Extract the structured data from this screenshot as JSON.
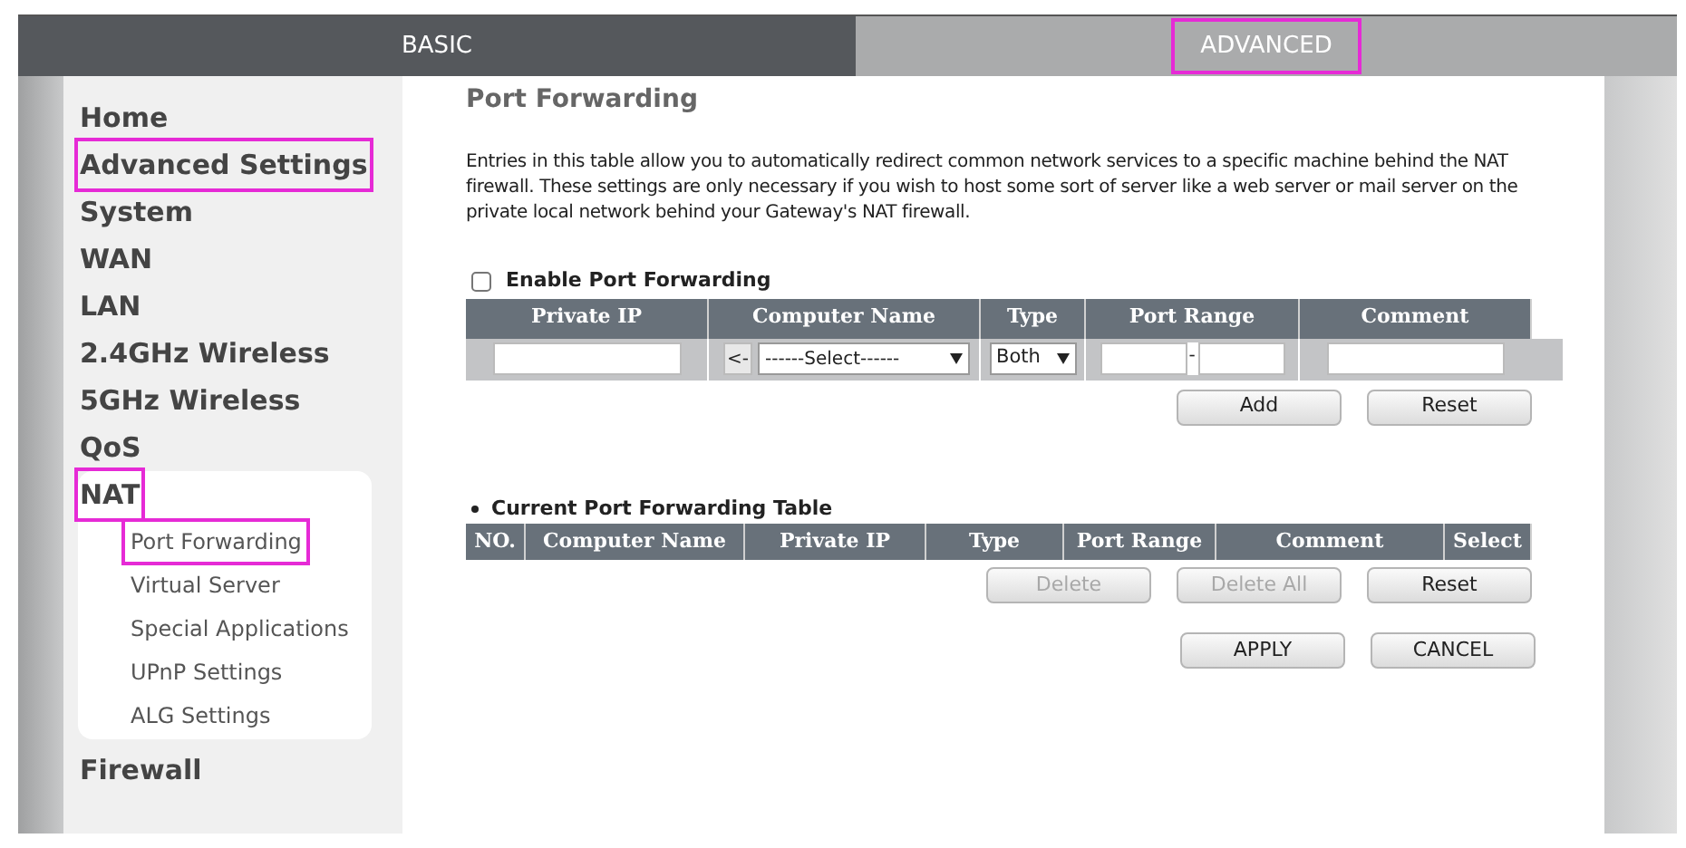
{
  "tabs": [
    {
      "label": "BASIC",
      "selected": true,
      "highlighted": false
    },
    {
      "label": "ADVANCED",
      "selected": false,
      "highlighted": true
    }
  ],
  "sidebar": {
    "items": [
      {
        "label": "Home",
        "highlighted": false
      },
      {
        "label": "Advanced Settings",
        "highlighted": true
      },
      {
        "label": "System",
        "highlighted": false
      },
      {
        "label": "WAN",
        "highlighted": false
      },
      {
        "label": "LAN",
        "highlighted": false
      },
      {
        "label": "2.4GHz Wireless",
        "highlighted": false
      },
      {
        "label": "5GHz Wireless",
        "highlighted": false
      },
      {
        "label": "QoS",
        "highlighted": false
      },
      {
        "label": "NAT",
        "highlighted": true,
        "children": [
          {
            "label": "Port Forwarding",
            "highlighted": true
          },
          {
            "label": "Virtual Server",
            "highlighted": false
          },
          {
            "label": "Special Applications",
            "highlighted": false
          },
          {
            "label": "UPnP Settings",
            "highlighted": false
          },
          {
            "label": "ALG Settings",
            "highlighted": false
          }
        ]
      },
      {
        "label": "Firewall",
        "highlighted": false
      }
    ]
  },
  "content": {
    "title": "Port Forwarding",
    "description": "Entries in this table allow you to automatically redirect common network services to a specific machine behind the NAT firewall. These settings are only necessary if you wish to host some sort of server like a web server or mail server on the private local network behind your Gateway's NAT firewall.",
    "enable": {
      "label": "Enable Port Forwarding",
      "checked": false
    },
    "form_table": {
      "columns": [
        "Private IP",
        "Computer Name",
        "Type",
        "Port Range",
        "Comment"
      ],
      "copy_button": "<-",
      "computer_select": "------Select------",
      "type_select": "Both",
      "port_separator": "-"
    },
    "form_buttons": [
      {
        "label": "Add",
        "disabled": false
      },
      {
        "label": "Reset",
        "disabled": false
      }
    ],
    "current_table": {
      "title": "Current Port Forwarding Table",
      "columns": [
        "NO.",
        "Computer Name",
        "Private IP",
        "Type",
        "Port Range",
        "Comment",
        "Select"
      ]
    },
    "table_buttons": [
      {
        "label": "Delete",
        "disabled": true
      },
      {
        "label": "Delete All",
        "disabled": true
      },
      {
        "label": "Reset",
        "disabled": false
      }
    ],
    "actions": [
      {
        "label": "APPLY",
        "disabled": false
      },
      {
        "label": "CANCEL",
        "disabled": false
      }
    ]
  }
}
